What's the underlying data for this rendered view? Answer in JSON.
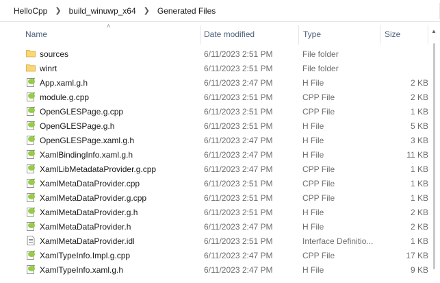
{
  "breadcrumb": [
    "HelloCpp",
    "build_winuwp_x64",
    "Generated Files"
  ],
  "columns": {
    "name": "Name",
    "date": "Date modified",
    "type": "Type",
    "size": "Size"
  },
  "files": [
    {
      "name": "sources",
      "date": "6/11/2023 2:51 PM",
      "type": "File folder",
      "size": "",
      "icon": "folder-icon"
    },
    {
      "name": "winrt",
      "date": "6/11/2023 2:51 PM",
      "type": "File folder",
      "size": "",
      "icon": "folder-icon"
    },
    {
      "name": "App.xaml.g.h",
      "date": "6/11/2023 2:47 PM",
      "type": "H File",
      "size": "2 KB",
      "icon": "notepadpp-file-icon"
    },
    {
      "name": "module.g.cpp",
      "date": "6/11/2023 2:51 PM",
      "type": "CPP File",
      "size": "2 KB",
      "icon": "notepadpp-file-icon"
    },
    {
      "name": "OpenGLESPage.g.cpp",
      "date": "6/11/2023 2:51 PM",
      "type": "CPP File",
      "size": "1 KB",
      "icon": "notepadpp-file-icon"
    },
    {
      "name": "OpenGLESPage.g.h",
      "date": "6/11/2023 2:51 PM",
      "type": "H File",
      "size": "5 KB",
      "icon": "notepadpp-file-icon"
    },
    {
      "name": "OpenGLESPage.xaml.g.h",
      "date": "6/11/2023 2:47 PM",
      "type": "H File",
      "size": "3 KB",
      "icon": "notepadpp-file-icon"
    },
    {
      "name": "XamlBindingInfo.xaml.g.h",
      "date": "6/11/2023 2:47 PM",
      "type": "H File",
      "size": "11 KB",
      "icon": "notepadpp-file-icon"
    },
    {
      "name": "XamlLibMetadataProvider.g.cpp",
      "date": "6/11/2023 2:47 PM",
      "type": "CPP File",
      "size": "1 KB",
      "icon": "notepadpp-file-icon"
    },
    {
      "name": "XamlMetaDataProvider.cpp",
      "date": "6/11/2023 2:51 PM",
      "type": "CPP File",
      "size": "1 KB",
      "icon": "notepadpp-file-icon"
    },
    {
      "name": "XamlMetaDataProvider.g.cpp",
      "date": "6/11/2023 2:51 PM",
      "type": "CPP File",
      "size": "1 KB",
      "icon": "notepadpp-file-icon"
    },
    {
      "name": "XamlMetaDataProvider.g.h",
      "date": "6/11/2023 2:51 PM",
      "type": "H File",
      "size": "2 KB",
      "icon": "notepadpp-file-icon"
    },
    {
      "name": "XamlMetaDataProvider.h",
      "date": "6/11/2023 2:47 PM",
      "type": "H File",
      "size": "2 KB",
      "icon": "notepadpp-file-icon"
    },
    {
      "name": "XamlMetaDataProvider.idl",
      "date": "6/11/2023 2:51 PM",
      "type": "Interface Definitio...",
      "size": "1 KB",
      "icon": "text-file-icon"
    },
    {
      "name": "XamlTypeInfo.Impl.g.cpp",
      "date": "6/11/2023 2:47 PM",
      "type": "CPP File",
      "size": "17 KB",
      "icon": "notepadpp-file-icon"
    },
    {
      "name": "XamlTypeInfo.xaml.g.h",
      "date": "6/11/2023 2:47 PM",
      "type": "H File",
      "size": "9 KB",
      "icon": "notepadpp-file-icon"
    }
  ],
  "colors": {
    "folder": "#f8d775",
    "notepadpp": "#8fc93a",
    "header_text": "#4c607a"
  }
}
